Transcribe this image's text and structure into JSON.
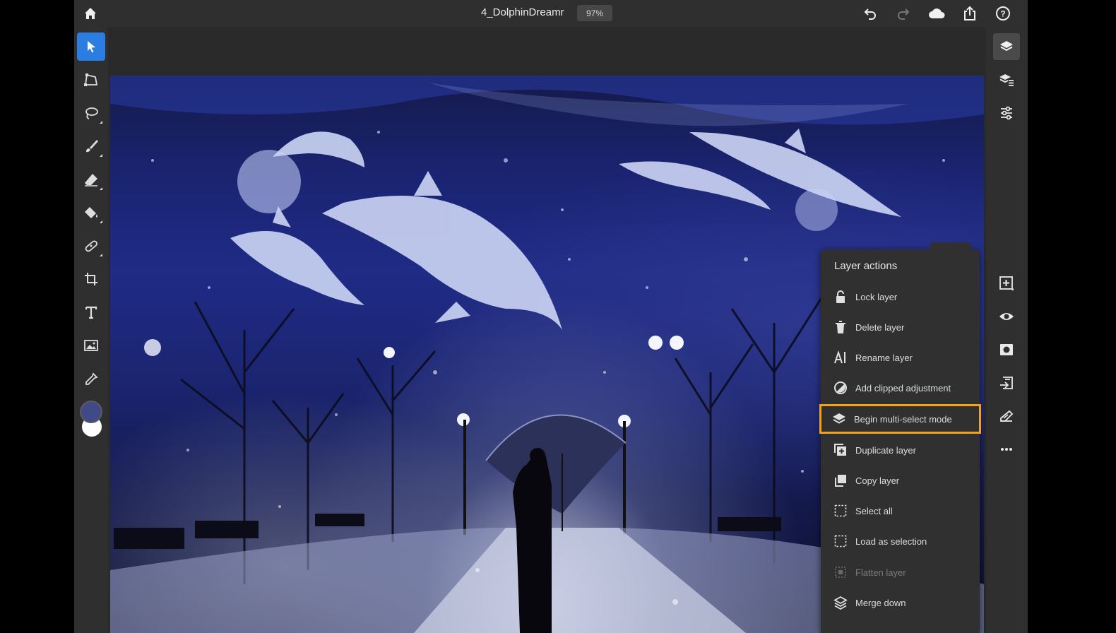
{
  "topbar": {
    "doc_title": "4_DolphinDreamr",
    "zoom": "97%",
    "icons": [
      "home-icon",
      "undo-icon",
      "redo-icon",
      "cloud-icon",
      "share-icon",
      "help-icon"
    ]
  },
  "left_tools": [
    "select-tool",
    "transform-tool",
    "lasso-tool",
    "brush-tool",
    "eraser-tool",
    "fill-tool",
    "healing-tool",
    "crop-tool",
    "type-tool",
    "place-image-tool",
    "eyedropper-tool"
  ],
  "colors": {
    "foreground": "#3f4a86",
    "background": "#ffffff",
    "accent_active": "#2b7de1",
    "highlight_outline": "#f2a11a"
  },
  "right_rail": [
    "layers-icon",
    "layer-properties-icon",
    "adjustments-icon",
    "add-layer-icon",
    "visibility-icon",
    "mask-icon",
    "import-icon",
    "clip-icon",
    "more-icon"
  ],
  "layer_actions": {
    "title": "Layer actions",
    "items": [
      {
        "label": "Lock layer",
        "icon": "lock-icon",
        "enabled": true
      },
      {
        "label": "Delete layer",
        "icon": "trash-icon",
        "enabled": true
      },
      {
        "label": "Rename layer",
        "icon": "rename-icon",
        "enabled": true
      },
      {
        "label": "Add clipped adjustment",
        "icon": "adjustment-icon",
        "enabled": true
      },
      {
        "label": "Begin multi-select mode",
        "icon": "layers-stack-icon",
        "enabled": true,
        "highlighted": true
      },
      {
        "label": "Duplicate layer",
        "icon": "duplicate-icon",
        "enabled": true
      },
      {
        "label": "Copy layer",
        "icon": "copy-icon",
        "enabled": true
      },
      {
        "label": "Select all",
        "icon": "select-all-icon",
        "enabled": true
      },
      {
        "label": "Load as selection",
        "icon": "load-selection-icon",
        "enabled": true
      },
      {
        "label": "Flatten layer",
        "icon": "flatten-icon",
        "enabled": false
      },
      {
        "label": "Merge down",
        "icon": "merge-down-icon",
        "enabled": true
      }
    ]
  }
}
